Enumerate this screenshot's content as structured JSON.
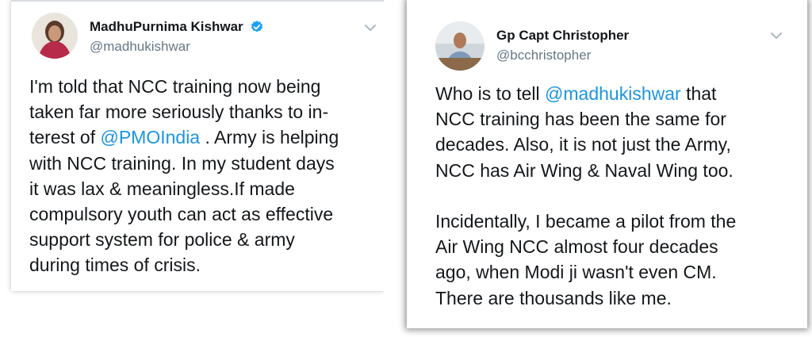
{
  "tweets": [
    {
      "author_name": "MadhuPurnima Kishwar",
      "handle": "@madhukishwar",
      "verified": true,
      "lines": [
        [
          "I'm told that NCC training now being"
        ],
        [
          "taken far more seriously thanks to in-"
        ],
        [
          "terest of ",
          "@PMOIndia",
          " . Army is helping"
        ],
        [
          "with NCC training. In my student days"
        ],
        [
          "it was lax & meaningless.If made"
        ],
        [
          "compulsory youth can act as effective"
        ],
        [
          "support system for police & army"
        ],
        [
          "during times of crisis."
        ]
      ]
    },
    {
      "author_name": "Gp Capt Christopher",
      "handle": "@bcchristopher",
      "verified": false,
      "lines": [
        [
          "Who is to tell ",
          "@madhukishwar",
          " that"
        ],
        [
          "NCC training has been the same for"
        ],
        [
          "decades. Also, it is not just the Army,"
        ],
        [
          "NCC has Air Wing & Naval Wing too."
        ],
        [],
        [
          "Incidentally, I became a pilot from the"
        ],
        [
          "Air Wing NCC almost four decades"
        ],
        [
          "ago, when Modi ji wasn't even CM."
        ],
        [
          "There are thousands like me."
        ]
      ]
    }
  ],
  "colors": {
    "text": "#14171a",
    "handle": "#657786",
    "mention": "#1b95e0",
    "verified": "#1da1f2"
  },
  "icons": {
    "verified": "verified-badge-icon",
    "menu": "chevron-down-icon"
  }
}
